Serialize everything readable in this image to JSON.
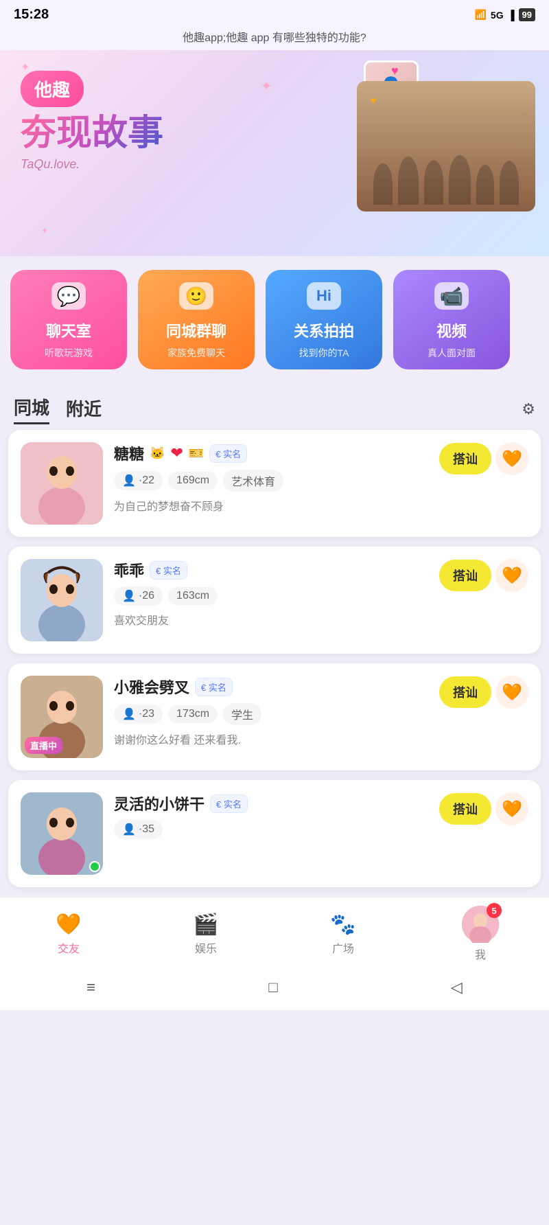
{
  "statusBar": {
    "time": "15:28",
    "networkLabel": "5G",
    "battery": "99",
    "icons": [
      "sim1",
      "sim2",
      "wifi",
      "signal",
      "battery"
    ]
  },
  "titleBar": {
    "text": "他趣app;他趣 app 有哪些独特的功能?"
  },
  "hero": {
    "badgeText": "他趣",
    "mainTitle": "夯现故事",
    "subtitle": "TaQu.love.",
    "photoAlt": "夯现故事 group photo"
  },
  "features": [
    {
      "id": "chatroom",
      "name": "聊天室",
      "desc": "听歌玩游戏",
      "iconEmoji": "💬",
      "colorClass": "feat-pink"
    },
    {
      "id": "group-chat",
      "name": "同城群聊",
      "desc": "家族免费聊天",
      "iconEmoji": "🙂",
      "colorClass": "feat-orange"
    },
    {
      "id": "relation-snap",
      "name": "关系拍拍",
      "desc": "找到你的TA",
      "iconEmoji": "Hi",
      "colorClass": "feat-blue"
    },
    {
      "id": "video",
      "name": "视频",
      "desc": "真人面对面",
      "iconEmoji": "📹",
      "colorClass": "feat-purple"
    }
  ],
  "tabs": {
    "items": [
      "同城",
      "附近"
    ],
    "activeIndex": 0,
    "settingsLabel": "⚙"
  },
  "users": [
    {
      "id": "user1",
      "name": "糖糖",
      "verified": true,
      "verifiedLabel": "€ 实名",
      "hasHeart": true,
      "hasCat": true,
      "age": "·22",
      "height": "169cm",
      "interest": "艺术体育",
      "bio": "为自己的梦想奋不顾身",
      "isLive": false,
      "isOnline": false,
      "greetBtn": "搭讪",
      "avatarGrad": "avatar-1"
    },
    {
      "id": "user2",
      "name": "乖乖",
      "verified": true,
      "verifiedLabel": "€ 实名",
      "hasHeart": false,
      "hasCat": false,
      "age": "·26",
      "height": "163cm",
      "interest": "",
      "bio": "喜欢交朋友",
      "isLive": false,
      "isOnline": false,
      "greetBtn": "搭讪",
      "avatarGrad": "avatar-2"
    },
    {
      "id": "user3",
      "name": "小雅会劈叉",
      "verified": true,
      "verifiedLabel": "€ 实名",
      "hasHeart": false,
      "hasCat": false,
      "age": "·23",
      "height": "173cm",
      "interest": "学生",
      "bio": "谢谢你这么好看 还来看我.",
      "isLive": true,
      "liveBadge": "直播中",
      "isOnline": false,
      "greetBtn": "搭讪",
      "avatarGrad": "avatar-3"
    },
    {
      "id": "user4",
      "name": "灵活的小饼干",
      "verified": true,
      "verifiedLabel": "€ 实名",
      "hasHeart": false,
      "hasCat": false,
      "age": "·35",
      "height": "",
      "interest": "",
      "bio": "",
      "isLive": false,
      "isOnline": true,
      "greetBtn": "搭讪",
      "avatarGrad": "avatar-4"
    }
  ],
  "bottomNav": {
    "items": [
      {
        "id": "friends",
        "label": "交友",
        "emoji": "🧡",
        "active": true
      },
      {
        "id": "entertainment",
        "label": "娱乐",
        "emoji": "🎬",
        "active": false
      },
      {
        "id": "plaza",
        "label": "广场",
        "emoji": "🐾",
        "active": false
      },
      {
        "id": "profile-nav",
        "label": "我",
        "isAvatar": true,
        "badgeCount": "5",
        "active": false
      }
    ]
  },
  "androidNav": {
    "buttons": [
      "≡",
      "□",
      "◁"
    ]
  }
}
